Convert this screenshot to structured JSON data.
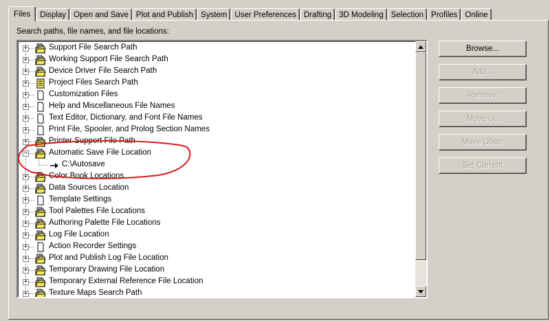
{
  "tabs": [
    {
      "label": "Files",
      "active": true
    },
    {
      "label": "Display"
    },
    {
      "label": "Open and Save"
    },
    {
      "label": "Plot and Publish"
    },
    {
      "label": "System"
    },
    {
      "label": "User Preferences"
    },
    {
      "label": "Drafting"
    },
    {
      "label": "3D Modeling"
    },
    {
      "label": "Selection"
    },
    {
      "label": "Profiles"
    },
    {
      "label": "Online"
    }
  ],
  "section_label": "Search paths, file names, and file locations:",
  "tree": [
    {
      "label": "Support File Search Path",
      "icon": "folder-docs-icon",
      "expanded": false
    },
    {
      "label": "Working Support File Search Path",
      "icon": "folder-docs-icon",
      "expanded": false
    },
    {
      "label": "Device Driver File Search Path",
      "icon": "folder-docs-icon",
      "expanded": false
    },
    {
      "label": "Project Files Search Path",
      "icon": "project-files-icon",
      "expanded": false
    },
    {
      "label": "Customization Files",
      "icon": "document-icon",
      "expanded": false
    },
    {
      "label": "Help and Miscellaneous File Names",
      "icon": "document-icon",
      "expanded": false
    },
    {
      "label": "Text Editor, Dictionary, and Font File Names",
      "icon": "document-icon",
      "expanded": false
    },
    {
      "label": "Print File, Spooler, and Prolog Section Names",
      "icon": "document-icon",
      "expanded": false
    },
    {
      "label": "Printer Support File Path",
      "icon": "folder-docs-icon",
      "expanded": false
    },
    {
      "label": "Automatic Save File Location",
      "icon": "folder-docs-icon",
      "expanded": true,
      "children": [
        {
          "label": "C:\\Autosave"
        }
      ]
    },
    {
      "label": "Color Book Locations",
      "icon": "folder-docs-icon",
      "expanded": false
    },
    {
      "label": "Data Sources Location",
      "icon": "folder-docs-icon",
      "expanded": false
    },
    {
      "label": "Template Settings",
      "icon": "document-icon",
      "expanded": false
    },
    {
      "label": "Tool Palettes File Locations",
      "icon": "folder-docs-icon",
      "expanded": false
    },
    {
      "label": "Authoring Palette File Locations",
      "icon": "folder-docs-icon",
      "expanded": false
    },
    {
      "label": "Log File Location",
      "icon": "folder-docs-icon",
      "expanded": false
    },
    {
      "label": "Action Recorder Settings",
      "icon": "document-icon",
      "expanded": false
    },
    {
      "label": "Plot and Publish Log File Location",
      "icon": "folder-docs-icon",
      "expanded": false
    },
    {
      "label": "Temporary Drawing File Location",
      "icon": "folder-docs-icon",
      "expanded": false
    },
    {
      "label": "Temporary External Reference File Location",
      "icon": "folder-docs-icon",
      "expanded": false
    },
    {
      "label": "Texture Maps Search Path",
      "icon": "folder-docs-icon",
      "expanded": false
    }
  ],
  "buttons": [
    {
      "label": "Browse...",
      "enabled": true
    },
    {
      "label": "Add...",
      "enabled": false
    },
    {
      "label": "Remove",
      "enabled": false
    },
    {
      "label": "Move Up",
      "enabled": false
    },
    {
      "label": "Move Down",
      "enabled": false
    },
    {
      "label": "Set Current",
      "enabled": false
    }
  ],
  "colors": {
    "folder": "#f5e85c",
    "annotation": "#d81818"
  }
}
